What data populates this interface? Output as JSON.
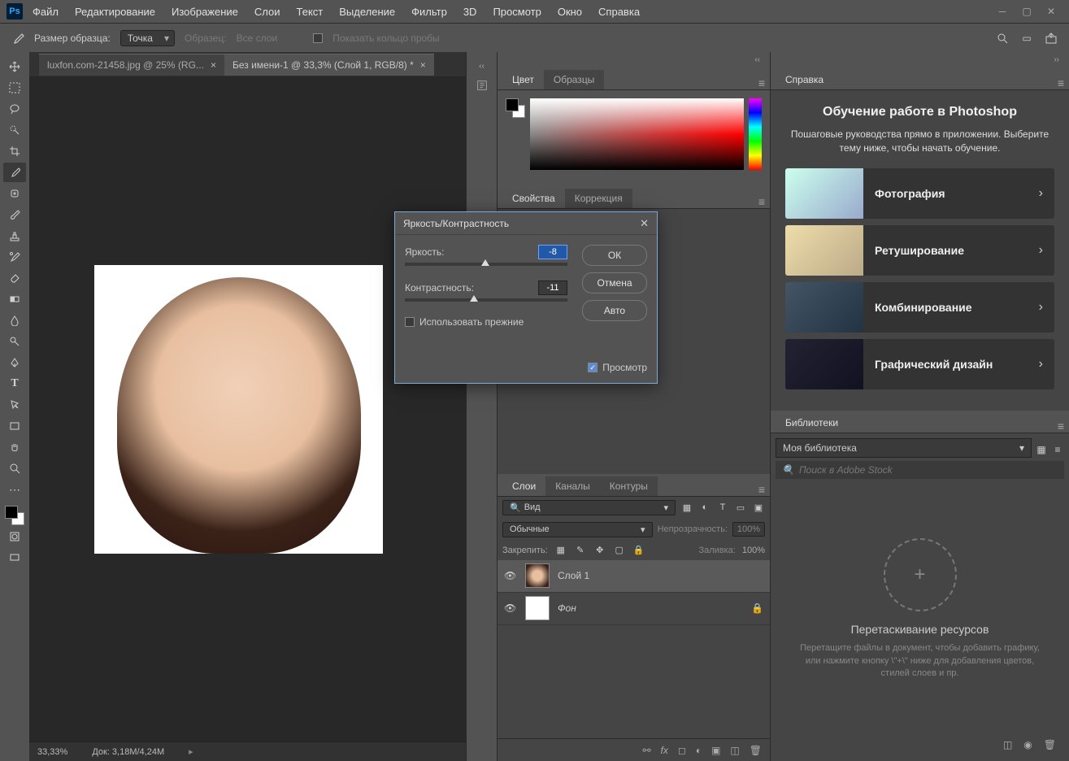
{
  "menu": [
    "Файл",
    "Редактирование",
    "Изображение",
    "Слои",
    "Текст",
    "Выделение",
    "Фильтр",
    "3D",
    "Просмотр",
    "Окно",
    "Справка"
  ],
  "optionbar": {
    "size_label": "Размер образца:",
    "size_value": "Точка",
    "sample_label": "Образец:",
    "sample_value": "Все слои",
    "ring": "Показать кольцо пробы"
  },
  "tabs": [
    {
      "label": "luxfon.com-21458.jpg @ 25% (RG...",
      "active": false
    },
    {
      "label": "Без имени-1 @ 33,3% (Слой 1, RGB/8) *",
      "active": true
    }
  ],
  "status": {
    "zoom": "33,33%",
    "doc": "Док: 3,18M/4,24M"
  },
  "panel_color": {
    "tabs": [
      "Цвет",
      "Образцы"
    ]
  },
  "panel_props": {
    "tabs": [
      "Свойства",
      "Коррекция"
    ]
  },
  "panel_layers": {
    "tabs": [
      "Слои",
      "Каналы",
      "Контуры"
    ],
    "kind": "Вид",
    "blend": "Обычные",
    "opacity_label": "Непрозрачность:",
    "opacity": "100%",
    "lock_label": "Закрепить:",
    "fill_label": "Заливка:",
    "fill": "100%",
    "layers": [
      {
        "name": "Слой 1",
        "sel": true,
        "img": true,
        "locked": false
      },
      {
        "name": "Фон",
        "sel": false,
        "img": false,
        "locked": true
      }
    ]
  },
  "help": {
    "tab": "Справка",
    "title": "Обучение работе в Photoshop",
    "sub": "Пошаговые руководства прямо в приложении. Выберите тему ниже, чтобы начать обучение.",
    "lessons": [
      "Фотография",
      "Ретуширование",
      "Комбинирование",
      "Графический дизайн"
    ]
  },
  "lib": {
    "tab": "Библиотеки",
    "sel": "Моя библиотека",
    "search": "Поиск в Adobe Stock",
    "drop_title": "Перетаскивание ресурсов",
    "drop_desc": "Перетащите файлы в документ, чтобы добавить графику, или нажмите кнопку \\\"+\\\" ниже для добавления цветов, стилей слоев и пр."
  },
  "dialog": {
    "title": "Яркость/Контрастность",
    "brightness": {
      "label": "Яркость:",
      "value": "-8"
    },
    "contrast": {
      "label": "Контрастность:",
      "value": "-11"
    },
    "legacy": "Использовать прежние",
    "preview": "Просмотр",
    "ok": "ОК",
    "cancel": "Отмена",
    "auto": "Авто"
  }
}
